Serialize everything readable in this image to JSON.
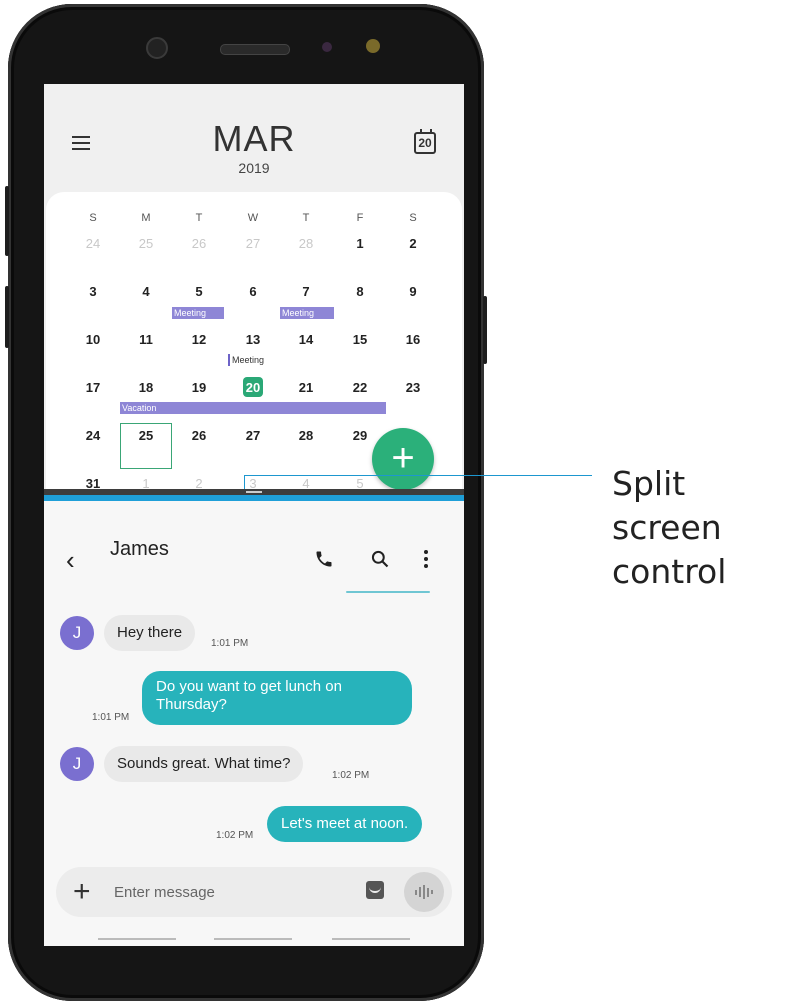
{
  "calendar": {
    "month": "MAR",
    "year": "2019",
    "today_badge": "20",
    "weekdays": [
      "S",
      "M",
      "T",
      "W",
      "T",
      "F",
      "S"
    ],
    "weeks": [
      [
        "24",
        "25",
        "26",
        "27",
        "28",
        "1",
        "2"
      ],
      [
        "3",
        "4",
        "5",
        "6",
        "7",
        "8",
        "9"
      ],
      [
        "10",
        "11",
        "12",
        "13",
        "14",
        "15",
        "16"
      ],
      [
        "17",
        "18",
        "19",
        "20",
        "21",
        "22",
        "23"
      ],
      [
        "24",
        "25",
        "26",
        "27",
        "28",
        "29",
        ""
      ],
      [
        "31",
        "1",
        "2",
        "3",
        "4",
        "5",
        ""
      ]
    ],
    "events": {
      "meeting1": "Meeting",
      "meeting2": "Meeting",
      "meeting3": "Meeting",
      "vacation": "Vacation"
    },
    "fab_label": "+"
  },
  "chat": {
    "contact": "James",
    "avatar_initial": "J",
    "messages": [
      {
        "text": "Hey there",
        "time": "1:01 PM"
      },
      {
        "text": "Do you want to get lunch on Thursday?",
        "line1": "Do you want to get lunch on",
        "line2": "Thursday?",
        "time": "1:01 PM"
      },
      {
        "text": "Sounds great. What time?",
        "time": "1:02 PM"
      },
      {
        "text": "Let's meet at noon.",
        "time": "1:02 PM"
      }
    ],
    "input_placeholder": "Enter message"
  },
  "callout": {
    "line1": "Split screen",
    "line2": "control"
  },
  "colors": {
    "accent_green": "#2bb07a",
    "divider_blue": "#1f9fd8",
    "bubble_out": "#27b3bb",
    "avatar": "#7a6fd0",
    "event": "#8e86d6"
  },
  "icons": [
    "menu-icon",
    "calendar-icon",
    "add-icon",
    "back-icon",
    "phone-icon",
    "search-icon",
    "more-icon",
    "sticker-icon",
    "voice-icon"
  ]
}
